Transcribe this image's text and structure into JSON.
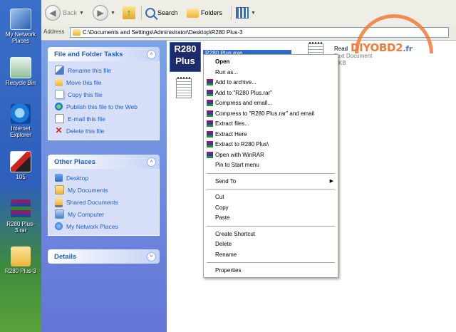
{
  "desktop": {
    "icons": [
      {
        "label": "My Network Places",
        "icon": "network-places-icon"
      },
      {
        "label": "Recycle Bin",
        "icon": "recycle-bin-icon"
      },
      {
        "label": "Internet Explorer",
        "icon": "internet-explorer-icon"
      },
      {
        "label": "105",
        "icon": "application-icon"
      },
      {
        "label": "R280 Plus-3.rar",
        "icon": "winrar-archive-icon"
      },
      {
        "label": "R280 Plus-3",
        "icon": "folder-icon"
      }
    ]
  },
  "toolbar": {
    "back_label": "Back",
    "search_label": "Search",
    "folders_label": "Folders"
  },
  "address": {
    "label": "Address",
    "path": "C:\\Documents and Settings\\Administrator\\Desktop\\R280 Plus-3"
  },
  "tasks": {
    "file_folder": {
      "title": "File and Folder Tasks",
      "items": [
        "Rename this file",
        "Move this file",
        "Copy this file",
        "Publish this file to the Web",
        "E-mail this file",
        "Delete this file"
      ]
    },
    "other_places": {
      "title": "Other Places",
      "items": [
        "Desktop",
        "My Documents",
        "Shared Documents",
        "My Computer",
        "My Network Places"
      ]
    },
    "details": {
      "title": "Details"
    }
  },
  "content": {
    "selected_file": {
      "logo_line1": "R280",
      "logo_line2": "Plus",
      "name": "R280 Plus.exe"
    },
    "readme": {
      "name": "Read",
      "type": "Text Document",
      "size": "KB"
    }
  },
  "context_menu": {
    "items": [
      {
        "label": "Open",
        "bold": true
      },
      {
        "label": "Run as..."
      },
      {
        "label": "Add to archive...",
        "rar": true
      },
      {
        "label": "Add to \"R280 Plus.rar\"",
        "rar": true
      },
      {
        "label": "Compress and email...",
        "rar": true
      },
      {
        "label": "Compress to \"R280 Plus.rar\" and email",
        "rar": true
      },
      {
        "label": "Extract files...",
        "rar": true
      },
      {
        "label": "Extract Here",
        "rar": true
      },
      {
        "label": "Extract to R280 Plus\\",
        "rar": true
      },
      {
        "label": "Open with WinRAR",
        "rar": true
      },
      {
        "label": "Pin to Start menu"
      },
      {
        "sep": true
      },
      {
        "label": "Send To",
        "submenu": true
      },
      {
        "sep": true
      },
      {
        "label": "Cut"
      },
      {
        "label": "Copy"
      },
      {
        "label": "Paste"
      },
      {
        "sep": true
      },
      {
        "label": "Create Shortcut"
      },
      {
        "label": "Delete"
      },
      {
        "label": "Rename"
      },
      {
        "sep": true
      },
      {
        "label": "Properties"
      }
    ]
  },
  "watermark": {
    "text": "DIYOBD2",
    "suffix": ".fr"
  },
  "colors": {
    "selection": "#316ac5",
    "task_link": "#215dc6",
    "watermark": "#f27b38"
  }
}
